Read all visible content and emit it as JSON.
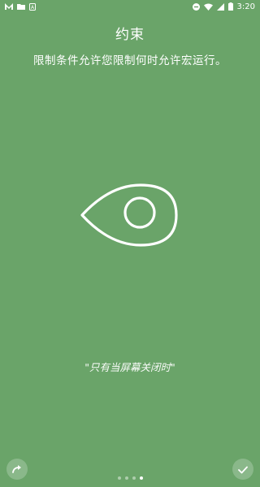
{
  "status_bar": {
    "left_icons": [
      "app-m-icon",
      "folder-icon",
      "sim-a-icon"
    ],
    "right_icons": [
      "dnd-icon",
      "wifi-icon",
      "cellular-icon",
      "battery-icon"
    ],
    "time": "3:20"
  },
  "page": {
    "title": "约束",
    "subtitle": "限制条件允许您限制何时允许宏运行。",
    "quote": "\"只有当屏幕关闭时\"",
    "illustration_icon": "eye-location-icon"
  },
  "nav": {
    "skip_icon": "redo-arrow-icon",
    "done_icon": "check-icon",
    "pages": 4,
    "active_page": 4
  },
  "colors": {
    "background": "#6aa469",
    "foreground": "#ffffff"
  }
}
